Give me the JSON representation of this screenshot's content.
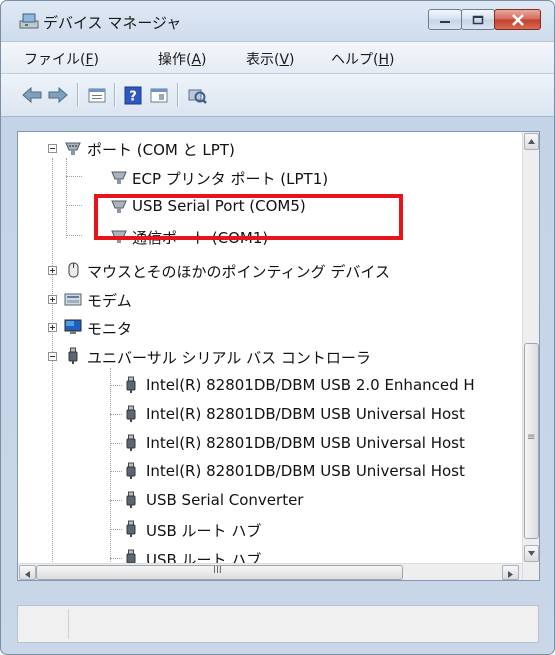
{
  "window": {
    "title": "デバイス マネージャ"
  },
  "menu": [
    {
      "label": "ファイル(",
      "key": "F",
      "suffix": ")"
    },
    {
      "label": "操作(",
      "key": "A",
      "suffix": ")"
    },
    {
      "label": "表示(",
      "key": "V",
      "suffix": ")"
    },
    {
      "label": "ヘルプ(",
      "key": "H",
      "suffix": ")"
    }
  ],
  "toolbar": {
    "icons": [
      "back-arrow-icon",
      "forward-arrow-icon",
      "properties-icon",
      "help-icon",
      "view-icon",
      "scan-hardware-icon"
    ]
  },
  "tree": {
    "ports_label": "ポート (COM と LPT)",
    "ports_children": [
      "ECP プリンタ ポート (LPT1)",
      "USB Serial Port (COM5)",
      "通信ポート (COM1)"
    ],
    "mouse_label": "マウスとそのほかのポインティング デバイス",
    "modem_label": "モデム",
    "monitor_label": "モニタ",
    "usb_label": "ユニバーサル シリアル バス コントローラ",
    "usb_children": [
      "Intel(R) 82801DB/DBM USB 2.0 Enhanced H",
      "Intel(R) 82801DB/DBM USB Universal Host",
      "Intel(R) 82801DB/DBM USB Universal Host",
      "Intel(R) 82801DB/DBM USB Universal Host",
      "USB Serial Converter",
      "USB ルート ハブ",
      "USB ルート ハブ"
    ]
  },
  "scrollbar": {
    "hscroll_glyph": "III",
    "vscroll_glyph": "≡"
  },
  "colors": {
    "highlight": "#e8141c",
    "title_bg": "#cfdcec"
  }
}
